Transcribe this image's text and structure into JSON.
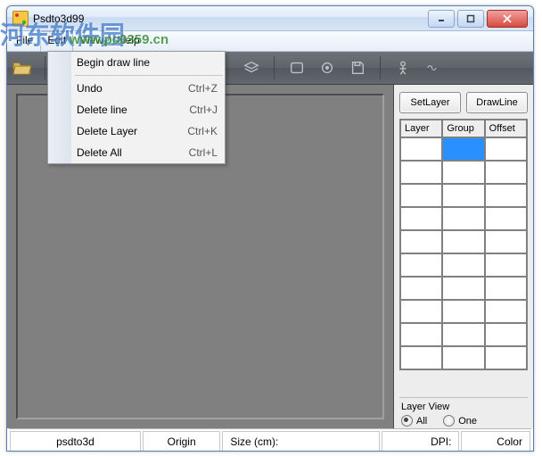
{
  "window": {
    "title": "Psdto3d99"
  },
  "menu": {
    "file": "File",
    "edit": "Edit",
    "view": "View",
    "help": "Help"
  },
  "dropdown": {
    "begin": "Begin draw line",
    "undo": "Undo",
    "undo_key": "Ctrl+Z",
    "del_line": "Delete line",
    "del_line_key": "Ctrl+J",
    "del_layer": "Delete Layer",
    "del_layer_key": "Ctrl+K",
    "del_all": "Delete All",
    "del_all_key": "Ctrl+L"
  },
  "side": {
    "set_layer": "SetLayer",
    "draw_line": "DrawLine",
    "col_layer": "Layer",
    "col_group": "Group",
    "col_offset": "Offset",
    "layer_view": "Layer View",
    "radio_all": "All",
    "radio_one": "One"
  },
  "status": {
    "app": "psdto3d",
    "origin": "Origin",
    "size": "Size (cm):",
    "dpi": "DPI:",
    "color": "Color"
  },
  "watermark": {
    "text": "河东软件园",
    "url": "www.pc0359.cn"
  }
}
